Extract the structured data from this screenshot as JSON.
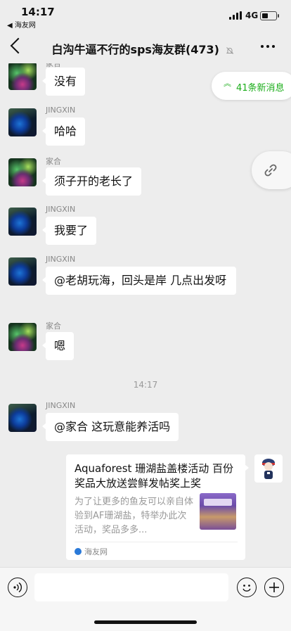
{
  "status_bar": {
    "time": "14:17",
    "back_app": "◀ 海友网",
    "network": "4G"
  },
  "nav": {
    "title": "白沟牛逼不行的sps海友群(473)",
    "more_icon": "more-dots-icon",
    "mute_icon": "bell-muted-icon"
  },
  "new_messages": {
    "label": "41条新消息",
    "icon": "double-chevron-up-icon",
    "color": "#1aad19"
  },
  "floating_link_icon": "link-icon",
  "messages": [
    {
      "sender": "家合",
      "text": "没有",
      "avatar": "coral"
    },
    {
      "sender": "JINGXIN",
      "text": "哈哈",
      "avatar": "fish"
    },
    {
      "sender": "家合",
      "text": "须子开的老长了",
      "avatar": "coral"
    },
    {
      "sender": "JINGXIN",
      "text": "我要了",
      "avatar": "fish"
    },
    {
      "sender": "JINGXIN",
      "text": "@老胡玩海，回头是岸 几点出发呀",
      "avatar": "fish"
    },
    {
      "sender": "家合",
      "text": "嗯",
      "avatar": "coral"
    },
    {
      "sender": "JINGXIN",
      "text": "@家合 这玩意能养活吗",
      "avatar": "fish"
    }
  ],
  "timestamp": "14:17",
  "shared_card": {
    "title": "Aquaforest 珊湖盐盖楼活动 百份奖品大放送尝鲜发帖奖上奖",
    "description": "为了让更多的鱼友可以亲自体验到AF珊湖盐，特举办此次活动，奖品多多...",
    "source": "海友网"
  },
  "input_bar": {
    "voice_icon": "voice-icon",
    "emoji_icon": "emoji-icon",
    "plus_icon": "plus-icon"
  }
}
